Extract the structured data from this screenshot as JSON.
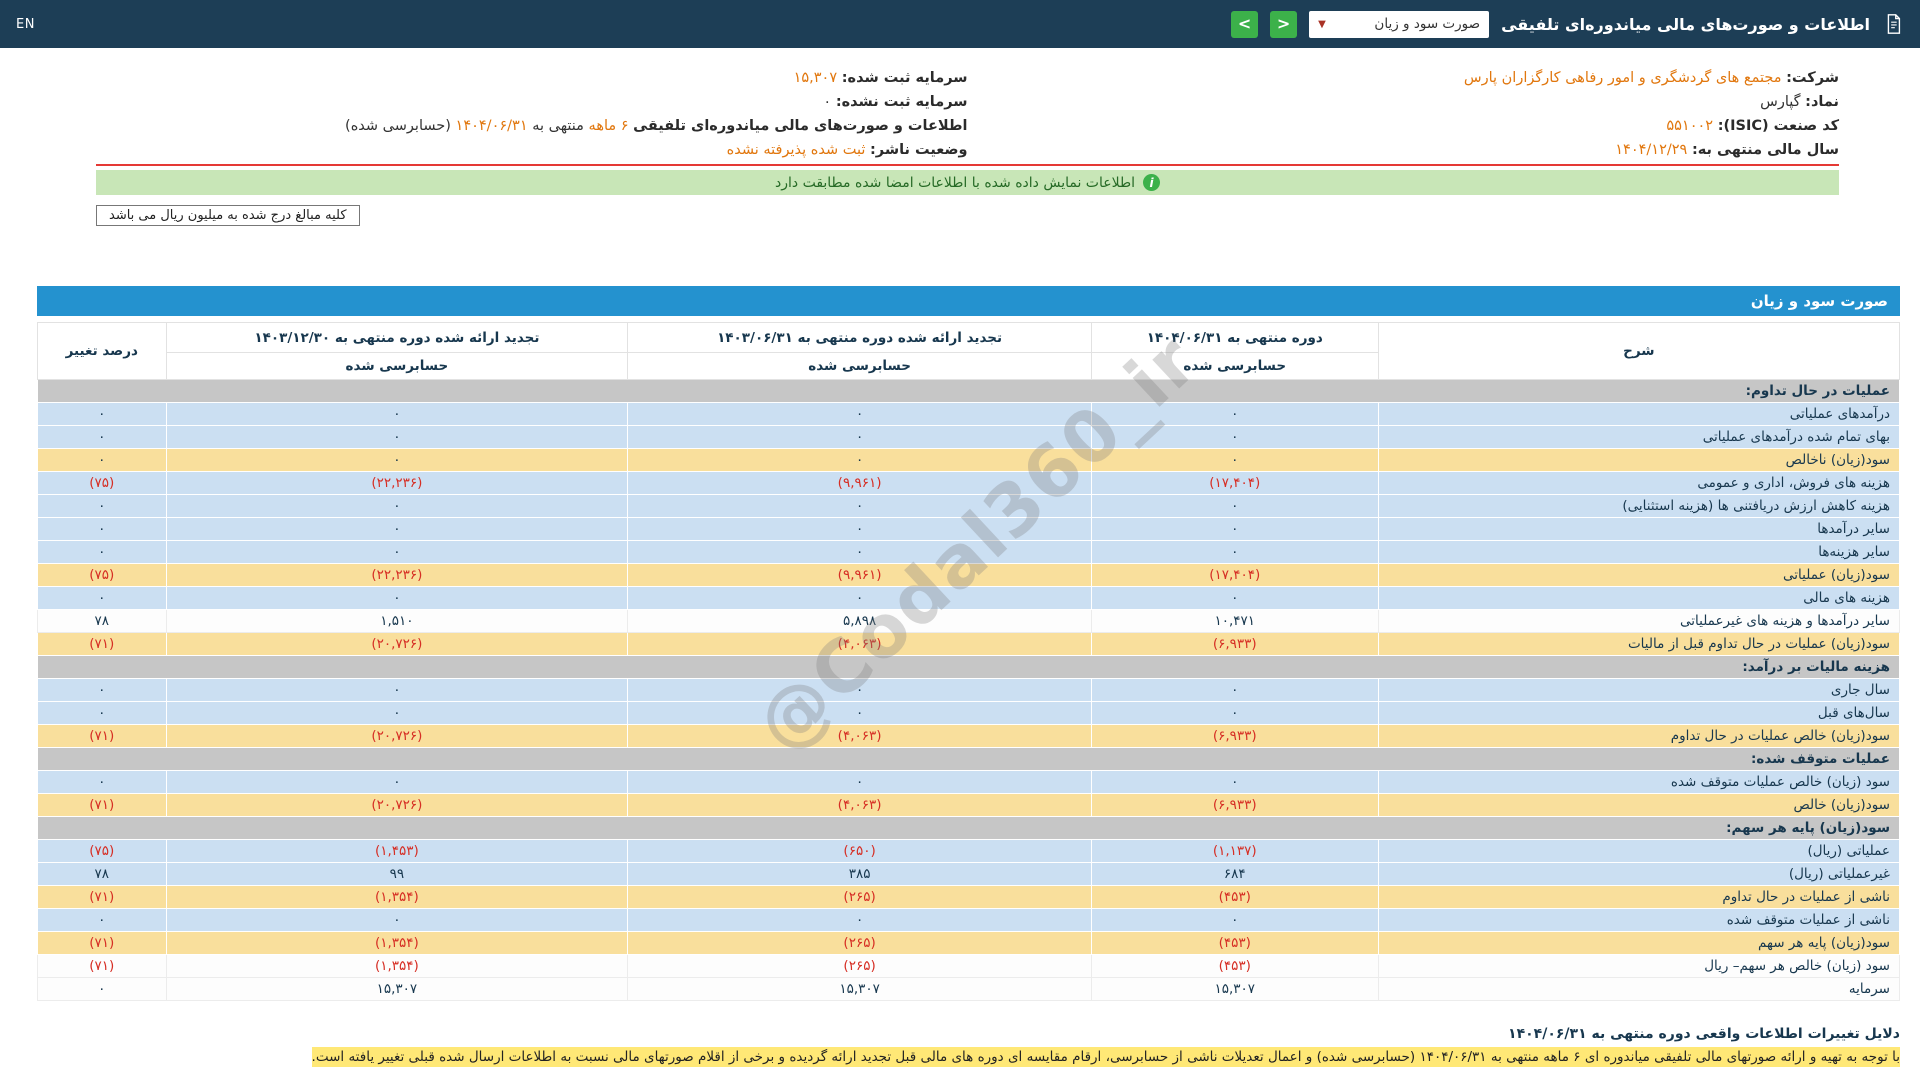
{
  "topbar": {
    "language_link": "EN",
    "page_title": "اطلاعات و صورت‌های مالی میاندوره‌ای تلفیقی",
    "statement_dropdown": {
      "selected": "صورت سود و زیان",
      "caret": "▼"
    },
    "nav_next": ">",
    "nav_prev": "<"
  },
  "company_info": {
    "right_column": [
      {
        "parts": [
          {
            "t": "شرکت:",
            "s": "label"
          },
          {
            "t": "مجتمع های گردشگری و امور رفاهی کارگزاران پارس",
            "s": "orange"
          }
        ]
      },
      {
        "parts": [
          {
            "t": "نماد:",
            "s": "label"
          },
          {
            "t": "گپارس",
            "s": "dark"
          }
        ]
      },
      {
        "parts": [
          {
            "t": "کد صنعت (ISIC):",
            "s": "label"
          },
          {
            "t": "۵۵۱۰۰۲",
            "s": "orange"
          }
        ]
      },
      {
        "parts": [
          {
            "t": "سال مالی منتهی به:",
            "s": "label"
          },
          {
            "t": "۱۴۰۴/۱۲/۲۹",
            "s": "orange"
          }
        ]
      }
    ],
    "left_column": [
      {
        "parts": [
          {
            "t": "سرمایه ثبت شده:",
            "s": "label"
          },
          {
            "t": "۱۵,۳۰۷",
            "s": "orange"
          }
        ]
      },
      {
        "parts": [
          {
            "t": "سرمایه ثبت نشده:",
            "s": "label"
          },
          {
            "t": "۰",
            "s": "dark"
          }
        ]
      },
      {
        "parts": [
          {
            "t": "اطلاعات و صورت‌های مالی میاندوره‌ای تلفیقی",
            "s": "label"
          },
          {
            "t": "۶ ماهه",
            "s": "orange"
          },
          {
            "t": "منتهی به",
            "s": "dark"
          },
          {
            "t": "۱۴۰۴/۰۶/۳۱",
            "s": "orange"
          },
          {
            "t": "(حسابرسی شده)",
            "s": "dark"
          }
        ]
      },
      {
        "parts": [
          {
            "t": "وضعیت ناشر:",
            "s": "label"
          },
          {
            "t": "ثبت شده پذیرفته نشده",
            "s": "orange"
          }
        ]
      }
    ]
  },
  "banner": {
    "icon": "i",
    "text": "اطلاعات نمایش داده شده با اطلاعات امضا شده مطابقت دارد"
  },
  "unit_note": "کلیه مبالغ درج شده به میلیون ریال می باشد",
  "watermark": "@Codal360_ir",
  "table": {
    "title": "صورت سود و زیان",
    "header": {
      "description": "شرح",
      "percent_change": "درصد تغییر",
      "audited": "حسابرسی شده",
      "periods": [
        "دوره منتهی به ۱۴۰۴/۰۶/۳۱",
        "تجدید ارائه شده دوره منتهی به ۱۴۰۳/۰۶/۳۱",
        "تجدید ارائه شده دوره منتهی به ۱۴۰۳/۱۲/۳۰"
      ]
    },
    "rows": [
      {
        "type": "section",
        "label": "عملیات در حال تداوم:"
      },
      {
        "type": "blue",
        "label": "درآمدهای عملیاتی",
        "values": [
          "۰",
          "۰",
          "۰",
          "۰"
        ]
      },
      {
        "type": "blue",
        "label": "بهای تمام شده درآمدهای عملیاتی",
        "values": [
          "۰",
          "۰",
          "۰",
          "۰"
        ]
      },
      {
        "type": "yellow",
        "label": "سود(زیان) ناخالص",
        "values": [
          "۰",
          "۰",
          "۰",
          "۰"
        ]
      },
      {
        "type": "blue",
        "label": "هزینه های فروش، اداری و عمومی",
        "values": [
          "(۱۷,۴۰۴)",
          "(۹,۹۶۱)",
          "(۲۲,۲۳۶)",
          "(۷۵)"
        ]
      },
      {
        "type": "blue",
        "label": "هزینه کاهش ارزش دریافتنی ها (هزینه استثنایی)",
        "values": [
          "۰",
          "۰",
          "۰",
          "۰"
        ]
      },
      {
        "type": "blue",
        "label": "سایر درآمدها",
        "values": [
          "۰",
          "۰",
          "۰",
          "۰"
        ]
      },
      {
        "type": "blue",
        "label": "سایر هزینه‌ها",
        "values": [
          "۰",
          "۰",
          "۰",
          "۰"
        ]
      },
      {
        "type": "yellow",
        "label": "سود(زیان) عملیاتی",
        "values": [
          "(۱۷,۴۰۴)",
          "(۹,۹۶۱)",
          "(۲۲,۲۳۶)",
          "(۷۵)"
        ]
      },
      {
        "type": "blue",
        "label": "هزینه های مالی",
        "values": [
          "۰",
          "۰",
          "۰",
          "۰"
        ]
      },
      {
        "type": "white",
        "label": "سایر درآمدها و هزینه های غیرعملیاتی",
        "values": [
          "۱۰,۴۷۱",
          "۵,۸۹۸",
          "۱,۵۱۰",
          "۷۸"
        ]
      },
      {
        "type": "yellow",
        "label": "سود(زیان) عملیات در حال تداوم قبل از مالیات",
        "values": [
          "(۶,۹۳۳)",
          "(۴,۰۶۳)",
          "(۲۰,۷۲۶)",
          "(۷۱)"
        ]
      },
      {
        "type": "section",
        "label": "هزینه مالیات بر درآمد:"
      },
      {
        "type": "blue",
        "label": "سال جاری",
        "values": [
          "۰",
          "۰",
          "۰",
          "۰"
        ]
      },
      {
        "type": "blue",
        "label": "سال‌های قبل",
        "values": [
          "۰",
          "۰",
          "۰",
          "۰"
        ]
      },
      {
        "type": "yellow",
        "label": "سود(زیان) خالص عملیات در حال تداوم",
        "values": [
          "(۶,۹۳۳)",
          "(۴,۰۶۳)",
          "(۲۰,۷۲۶)",
          "(۷۱)"
        ]
      },
      {
        "type": "section",
        "label": "عملیات متوقف شده:"
      },
      {
        "type": "blue",
        "label": "سود (زیان) خالص عملیات متوقف شده",
        "values": [
          "۰",
          "۰",
          "۰",
          "۰"
        ]
      },
      {
        "type": "yellow",
        "label": "سود(زیان) خالص",
        "values": [
          "(۶,۹۳۳)",
          "(۴,۰۶۳)",
          "(۲۰,۷۲۶)",
          "(۷۱)"
        ]
      },
      {
        "type": "section",
        "label": "سود(زیان) پایه هر سهم:"
      },
      {
        "type": "blue",
        "label": "عملیاتی (ریال)",
        "values": [
          "(۱,۱۳۷)",
          "(۶۵۰)",
          "(۱,۴۵۳)",
          "(۷۵)"
        ]
      },
      {
        "type": "blue",
        "label": "غیرعملیاتی (ریال)",
        "values": [
          "۶۸۴",
          "۳۸۵",
          "۹۹",
          "۷۸"
        ]
      },
      {
        "type": "yellow",
        "label": "ناشی از عملیات در حال تداوم",
        "values": [
          "(۴۵۳)",
          "(۲۶۵)",
          "(۱,۳۵۴)",
          "(۷۱)"
        ]
      },
      {
        "type": "blue",
        "label": "ناشی از عملیات متوقف شده",
        "values": [
          "۰",
          "۰",
          "۰",
          "۰"
        ]
      },
      {
        "type": "yellow",
        "label": "سود(زیان) پایه هر سهم",
        "values": [
          "(۴۵۳)",
          "(۲۶۵)",
          "(۱,۳۵۴)",
          "(۷۱)"
        ]
      },
      {
        "type": "white",
        "label": "سود (زیان) خالص هر سهم– ریال",
        "values": [
          "(۴۵۳)",
          "(۲۶۵)",
          "(۱,۳۵۴)",
          "(۷۱)"
        ]
      },
      {
        "type": "white",
        "label": "سرمایه",
        "values": [
          "۱۵,۳۰۷",
          "۱۵,۳۰۷",
          "۱۵,۳۰۷",
          "۰"
        ]
      }
    ]
  },
  "reasons": {
    "title": "دلایل تغییرات اطلاعات واقعی دوره منتهی به ۱۴۰۴/۰۶/۳۱",
    "text": "با توجه به تهیه و ارائه صورتهای مالی تلفیقی میاندوره ای ۶ ماهه منتهی به ۱۴۰۴/۰۶/۳۱ (حسابرسی شده) و اعمال تعدیلات ناشی از حسابرسی، ارقام مقایسه ای دوره های مالی قبل تجدید ارائه گردیده و برخی از اقلام صورتهای مالی نسبت به اطلاعات ارسال شده قبلی تغییر یافته است."
  }
}
